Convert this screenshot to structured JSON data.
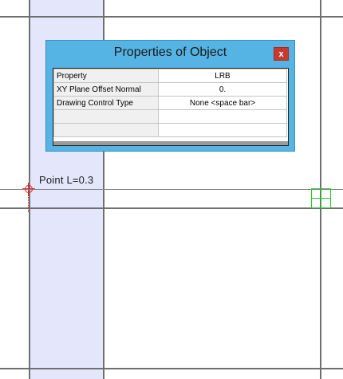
{
  "dialog": {
    "title": "Properties of Object",
    "close_label": "x",
    "table": {
      "header": [
        "Property",
        "LRB"
      ],
      "rows": [
        [
          "XY Plane Offset Normal",
          "0."
        ],
        [
          "Drawing Control Type",
          "None  <space bar>"
        ],
        [
          "",
          ""
        ],
        [
          "",
          ""
        ]
      ]
    }
  },
  "canvas": {
    "point_label": "Point  L=0.3",
    "colors": {
      "column_band": "#e4e7fb",
      "grid_line": "#6f6f6f",
      "snap_marker": "#e02222",
      "selection_box": "#22cc22",
      "dialog_frame": "#55b4e3",
      "close_button": "#c73a2f"
    }
  }
}
